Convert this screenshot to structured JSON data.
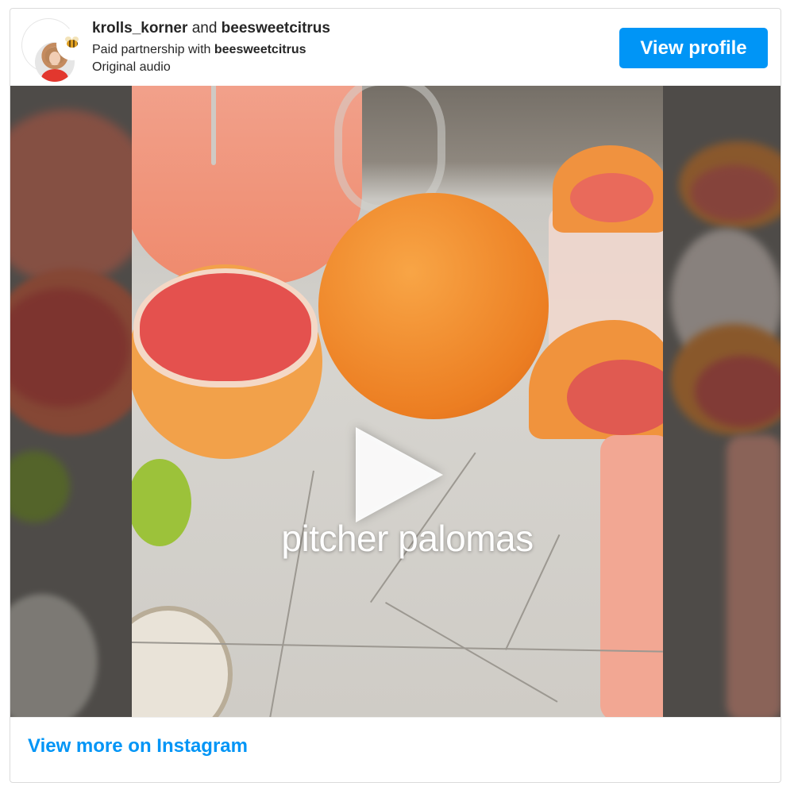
{
  "header": {
    "author_primary": "krolls_korner",
    "joiner": "and",
    "author_secondary": "beesweetcitrus",
    "partnership_prefix": "Paid partnership with",
    "partnership_brand": "beesweetcitrus",
    "audio": "Original audio",
    "view_profile_label": "View profile"
  },
  "media": {
    "overlay_text": "pitcher palomas",
    "play_icon": "play-icon"
  },
  "footer": {
    "more_label": "View more on Instagram"
  },
  "colors": {
    "accent": "#0095f6",
    "text": "#262626",
    "grapefruit": "#f3806a",
    "orange": "#ee8a2b",
    "lime": "#9cc23a"
  }
}
